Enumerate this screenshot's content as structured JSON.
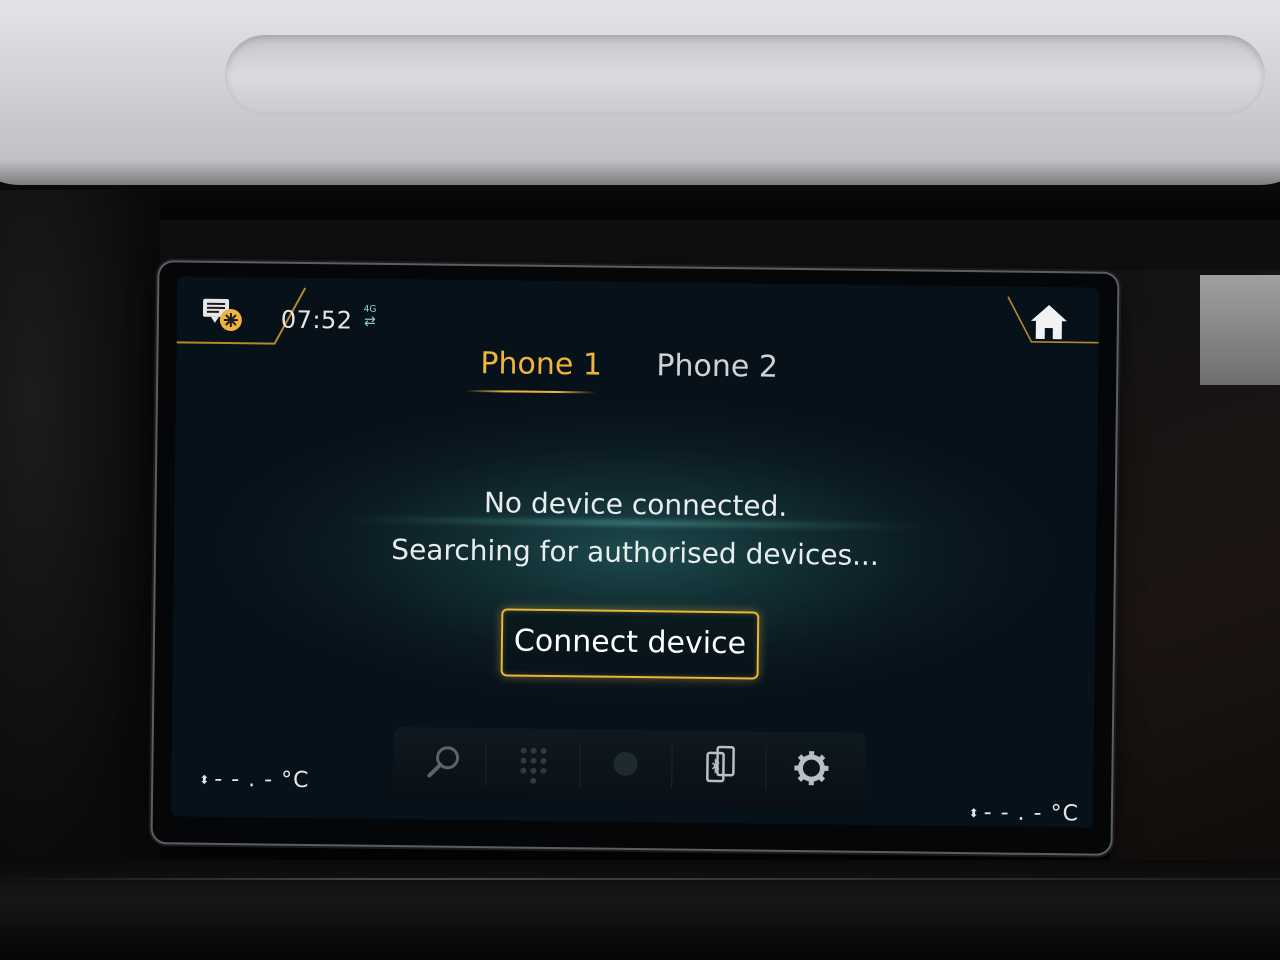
{
  "status_bar": {
    "time": "07:52",
    "network_type": "4G",
    "network_arrows": "⇄",
    "message_icon": "message-settings-icon"
  },
  "home": {
    "icon": "home-icon"
  },
  "tabs": [
    {
      "label": "Phone 1",
      "active": true
    },
    {
      "label": "Phone 2",
      "active": false
    }
  ],
  "main": {
    "line1": "No device connected.",
    "line2": "Searching for authorised devices...",
    "connect_button": "Connect device"
  },
  "dock": {
    "items": [
      {
        "icon": "search-icon"
      },
      {
        "icon": "keypad-icon"
      },
      {
        "icon": "contacts-icon"
      },
      {
        "icon": "phone-bluetooth-icon"
      },
      {
        "icon": "gear-icon"
      }
    ]
  },
  "climate": {
    "left_temp": "- - . - °C",
    "right_temp": "- - . - °C",
    "arrows": "⬍"
  },
  "colors": {
    "accent": "#f0b43e",
    "text": "#e8ecee",
    "screen_bg": "#0b1a22"
  }
}
